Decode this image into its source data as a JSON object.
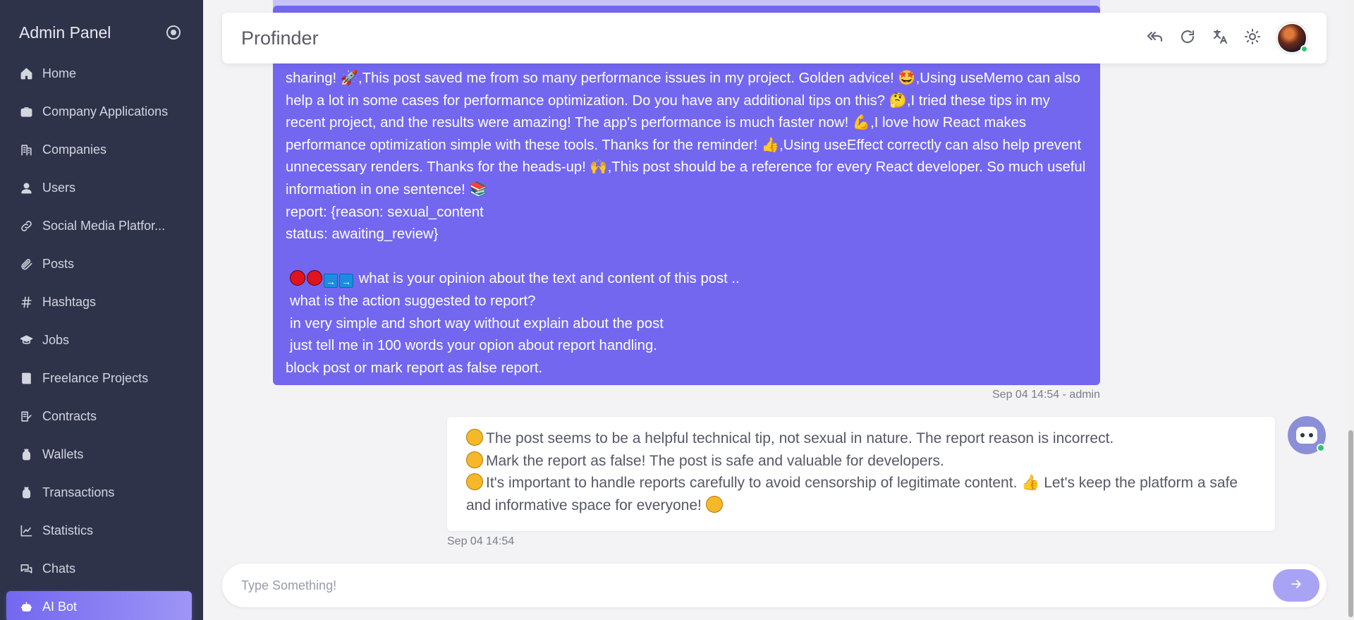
{
  "sidebar": {
    "title": "Admin Panel",
    "items": [
      {
        "label": "Home",
        "icon": "home-icon"
      },
      {
        "label": "Company Applications",
        "icon": "briefcase-icon"
      },
      {
        "label": "Companies",
        "icon": "building-icon"
      },
      {
        "label": "Users",
        "icon": "user-icon"
      },
      {
        "label": "Social Media Platfor...",
        "icon": "link-icon"
      },
      {
        "label": "Posts",
        "icon": "paperclip-icon"
      },
      {
        "label": "Hashtags",
        "icon": "hash-icon"
      },
      {
        "label": "Jobs",
        "icon": "graduation-cap-icon"
      },
      {
        "label": "Freelance Projects",
        "icon": "book-icon"
      },
      {
        "label": "Contracts",
        "icon": "signature-icon"
      },
      {
        "label": "Wallets",
        "icon": "money-bag-icon"
      },
      {
        "label": "Transactions",
        "icon": "money-bag-icon"
      },
      {
        "label": "Statistics",
        "icon": "chart-line-icon"
      },
      {
        "label": "Chats",
        "icon": "chat-bubbles-icon"
      },
      {
        "label": "AI Bot",
        "icon": "robot-icon",
        "active": true
      }
    ]
  },
  "header": {
    "brand": "Profinder",
    "icons": [
      "reply-all-icon",
      "refresh-icon",
      "translate-icon",
      "sun-icon",
      "avatar"
    ]
  },
  "chat": {
    "user_message": {
      "lines": [
        "sharing! 🚀,This post saved me from so many performance issues in my project. Golden advice! 🤩,Using useMemo can also help a lot in some cases for performance optimization. Do you have any additional tips on this? 🤔,I tried these tips in my recent project, and the results were amazing! The app's performance is much faster now! 💪,I love how React makes performance optimization simple with these tools. Thanks for the reminder! 👍,Using useEffect correctly can also help prevent unnecessary renders. Thanks for the heads-up! 🙌,This post should be a reference for every React developer. So much useful information in one sentence! 📚",
        "report: {reason: sexual_content",
        "status: awaiting_review}"
      ],
      "question_lines": [
        "what is your opinion about the text and content of this post ..",
        "what is the action suggested to report?",
        "in very simple and short way without explain about the post",
        "just tell me in 100 words your opion about report handling.",
        "block post or mark report as false report."
      ],
      "timestamp": "Sep 04 14:54 - admin"
    },
    "bot_message": {
      "line1": "The post seems to be a helpful technical tip, not sexual in nature. The report reason is incorrect.",
      "line2": "Mark the report as false! The post is safe and valuable for developers.",
      "line3a": "It's important to handle reports carefully to avoid censorship of legitimate content.",
      "line3b": "Let's keep the platform a safe and informative space for everyone!",
      "timestamp": "Sep 04 14:54"
    }
  },
  "composer": {
    "placeholder": "Type Something!"
  },
  "colors": {
    "accent": "#7367f0",
    "sidebar_bg": "#2f3349",
    "online": "#28c76f"
  }
}
